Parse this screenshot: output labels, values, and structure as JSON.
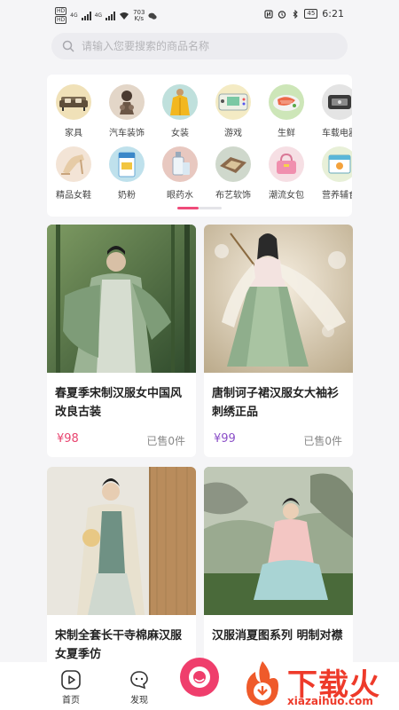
{
  "status_bar": {
    "sim1": "HD",
    "sim2": "HD",
    "net1": "4G",
    "net2": "4G",
    "speed_value": "703",
    "speed_unit": "K/s",
    "battery": "45",
    "time": "6:21"
  },
  "search": {
    "placeholder": "请输入您要搜索的商品名称"
  },
  "categories": {
    "row1": [
      {
        "label": "家具",
        "icon": "sofa-icon"
      },
      {
        "label": "汽车装饰",
        "icon": "car-ornament-icon"
      },
      {
        "label": "女装",
        "icon": "coat-icon"
      },
      {
        "label": "游戏",
        "icon": "game-console-icon"
      },
      {
        "label": "生鲜",
        "icon": "fresh-food-icon"
      },
      {
        "label": "车载电器",
        "icon": "car-appliance-icon"
      }
    ],
    "row2": [
      {
        "label": "精品女鞋",
        "icon": "heels-icon"
      },
      {
        "label": "奶粉",
        "icon": "milk-powder-icon"
      },
      {
        "label": "眼药水",
        "icon": "eye-drops-icon"
      },
      {
        "label": "布艺软饰",
        "icon": "rug-icon"
      },
      {
        "label": "潮流女包",
        "icon": "handbag-icon"
      },
      {
        "label": "营养辅食",
        "icon": "nutrition-icon"
      }
    ]
  },
  "products": [
    {
      "title": "春夏季宋制汉服女中国风改良古装",
      "price": "¥98",
      "sold": "已售0件",
      "price_color": "#e8446f"
    },
    {
      "title": "唐制诃子裙汉服女大袖衫刺绣正品",
      "price": "¥99",
      "sold": "已售0件",
      "price_color": "#8b4fc8"
    },
    {
      "title": "宋制全套长干寺棉麻汉服女夏季仿",
      "price": "",
      "sold": ""
    },
    {
      "title": "汉服消夏图系列 明制对襟",
      "price": "",
      "sold": ""
    }
  ],
  "nav": {
    "home": "首页",
    "discover": "发现"
  },
  "watermark": {
    "text": "下载火",
    "url": "xiazaihuo.com"
  },
  "colors": {
    "accent": "#ef3e6c",
    "background": "#f5f5f7"
  }
}
